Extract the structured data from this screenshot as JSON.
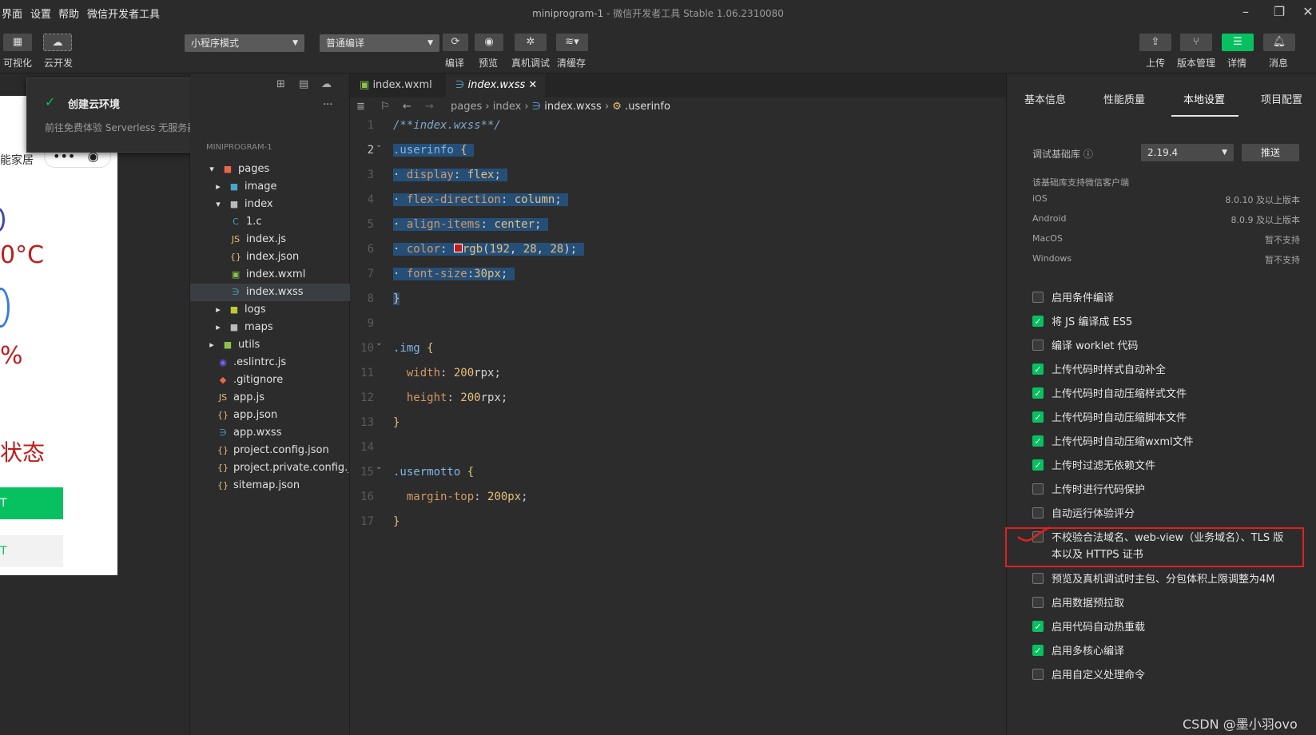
{
  "menubar": {
    "items": [
      "界面",
      "设置",
      "帮助",
      "微信开发者工具"
    ]
  },
  "window": {
    "project": "miniprogram-1",
    "subtitle": "- 微信开发者工具 Stable 1.06.2310080"
  },
  "toolbar": {
    "visual_label": "可视化",
    "cloud_label": "云开发",
    "mode_select": "小程序模式",
    "compile_select": "普通编译",
    "compile_label": "编译",
    "preview_label": "预览",
    "realdebug_label": "真机调试",
    "clearcache_label": "清缓存",
    "upload_label": "上传",
    "version_label": "版本管理",
    "detail_label": "详情",
    "message_label": "消息"
  },
  "popup": {
    "title": "创建云环境",
    "desc": "前往免费体验 Serverless 无服务器开发模式。"
  },
  "simulator": {
    "home": "能家居",
    "temp": "0°C",
    "humid": "%",
    "status": "状态",
    "btn1": "T",
    "btn2": "T"
  },
  "explorer": {
    "dots": "...",
    "project": "MINIPROGRAM-1",
    "items": [
      {
        "label": "pages"
      },
      {
        "label": "image"
      },
      {
        "label": "index"
      },
      {
        "label": "1.c"
      },
      {
        "label": "index.js"
      },
      {
        "label": "index.json"
      },
      {
        "label": "index.wxml"
      },
      {
        "label": "index.wxss"
      },
      {
        "label": "logs"
      },
      {
        "label": "maps"
      },
      {
        "label": "utils"
      },
      {
        "label": ".eslintrc.js"
      },
      {
        "label": ".gitignore"
      },
      {
        "label": "app.js"
      },
      {
        "label": "app.json"
      },
      {
        "label": "app.wxss"
      },
      {
        "label": "project.config.json"
      },
      {
        "label": "project.private.config.js..."
      },
      {
        "label": "sitemap.json"
      }
    ]
  },
  "tabs": [
    {
      "label": "index.wxml"
    },
    {
      "label": "index.wxss"
    }
  ],
  "breadcrumb": {
    "a": "pages",
    "b": "index",
    "c": "index.wxss",
    "d": ".userinfo"
  },
  "code": {
    "l1": "/**index.wxss**/",
    "l2a": ".userinfo",
    "l2b": " {",
    "l3a": "display",
    "l3b": ": ",
    "l3c": "flex",
    "l3d": ";",
    "l4a": "flex-direction",
    "l4b": ": ",
    "l4c": "column",
    "l4d": ";",
    "l5a": "align-items",
    "l5b": ": ",
    "l5c": "center",
    "l5d": ";",
    "l6a": "color",
    "l6b": ": ",
    "l6c": "rgb",
    "l6d": "(",
    "l6e": "192",
    "l6f": ", ",
    "l6g": "28",
    "l6h": ", ",
    "l6i": "28",
    "l6j": ");",
    "l7a": "font-size",
    "l7b": ":",
    "l7c": "30px",
    "l7d": ";",
    "l8": "}",
    "l10a": ".img",
    "l10b": " {",
    "l11a": "width",
    "l11b": ": ",
    "l11c": "200",
    "l11d": "rpx;",
    "l12a": "height",
    "l12b": ": ",
    "l12c": "200",
    "l12d": "rpx;",
    "l13": "}",
    "l15a": ".usermotto",
    "l15b": " {",
    "l16a": "margin-top",
    "l16b": ": ",
    "l16c": "200px",
    "l16d": ";",
    "l17": "}"
  },
  "line_numbers": [
    "1",
    "2",
    "3",
    "4",
    "5",
    "6",
    "7",
    "8",
    "9",
    "10",
    "11",
    "12",
    "13",
    "14",
    "15",
    "16",
    "17"
  ],
  "right": {
    "tabs": [
      "基本信息",
      "性能质量",
      "本地设置",
      "项目配置"
    ],
    "lib_label": "调试基础库",
    "lib_value": "2.19.4",
    "push_label": "推送",
    "support_title": "该基础库支持微信客户端",
    "platforms": [
      {
        "name": "iOS",
        "value": "8.0.10 及以上版本"
      },
      {
        "name": "Android",
        "value": "8.0.9 及以上版本"
      },
      {
        "name": "MacOS",
        "value": "暂不支持"
      },
      {
        "name": "Windows",
        "value": "暂不支持"
      }
    ],
    "options": [
      {
        "label": "启用条件编译",
        "checked": false
      },
      {
        "label": "将 JS 编译成 ES5",
        "checked": true
      },
      {
        "label": "编译 worklet 代码",
        "checked": false
      },
      {
        "label": "上传代码时样式自动补全",
        "checked": true
      },
      {
        "label": "上传代码时自动压缩样式文件",
        "checked": true
      },
      {
        "label": "上传代码时自动压缩脚本文件",
        "checked": true
      },
      {
        "label": "上传代码时自动压缩wxml文件",
        "checked": true
      },
      {
        "label": "上传时过滤无依赖文件",
        "checked": true
      },
      {
        "label": "上传时进行代码保护",
        "checked": false
      },
      {
        "label": "自动运行体验评分",
        "checked": false
      },
      {
        "label": "不校验合法域名、web-view（业务域名）、TLS 版",
        "label2": "本以及 HTTPS 证书",
        "checked": false
      },
      {
        "label": "预览及真机调试时主包、分包体积上限调整为4M",
        "checked": false
      },
      {
        "label": "启用数据预拉取",
        "checked": false
      },
      {
        "label": "启用代码自动热重载",
        "checked": true
      },
      {
        "label": "启用多核心编译",
        "checked": true
      },
      {
        "label": "启用自定义处理命令",
        "checked": false
      }
    ]
  },
  "watermark": "CSDN @墨小羽ovo"
}
